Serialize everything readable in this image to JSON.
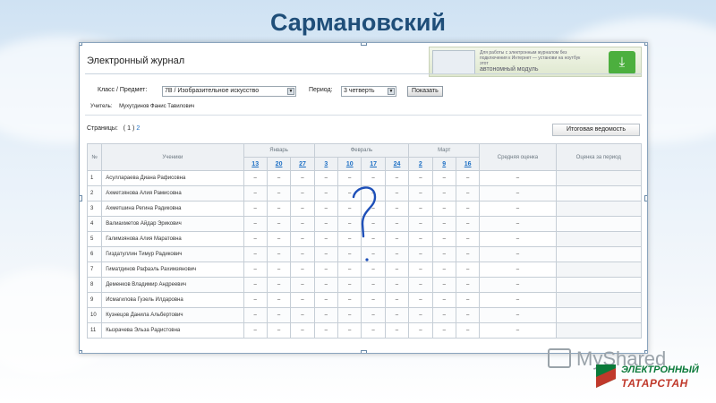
{
  "slide": {
    "title": "Сармановский"
  },
  "journal": {
    "title": "Электронный журнал",
    "promo": {
      "text": "Для работы с электронным журналом без подключения к Интернет — установи на ноутбук этот",
      "module_label": "автономный модуль",
      "download_icon": "download-icon"
    },
    "filters": {
      "class_label": "Класс / Предмет:",
      "class_value": "7В / Изобразительное искусство",
      "period_label": "Период:",
      "period_value": "3 четверть",
      "show_button": "Показать"
    },
    "teacher": {
      "label": "Учитель:",
      "name": "Мухутдинов Фанис Тавилович"
    },
    "pages": {
      "label": "Страницы:",
      "open": "(",
      "current": "1",
      "close": ")",
      "next": "2"
    },
    "summary_button": "Итоговая ведомость",
    "table": {
      "col_num": "№",
      "col_students": "Ученики",
      "months": [
        "Январь",
        "Февраль",
        "Март"
      ],
      "dates": [
        "13",
        "20",
        "27",
        "3",
        "10",
        "17",
        "24",
        "2",
        "9",
        "16"
      ],
      "col_avg": "Средняя оценка",
      "col_period": "Оценка за период",
      "rows": [
        {
          "num": "1",
          "name": "Асуллараева Диана Рафисовна"
        },
        {
          "num": "2",
          "name": "Ахметзянова Алия Рамисовна"
        },
        {
          "num": "3",
          "name": "Ахметшина Регина Радиковна"
        },
        {
          "num": "4",
          "name": "Валиахметов Айдар Эрикович"
        },
        {
          "num": "5",
          "name": "Галимзянова Алия Маратовна"
        },
        {
          "num": "6",
          "name": "Гиздатуллин Тимур Радикович"
        },
        {
          "num": "7",
          "name": "Гиматдинов Рафаэль Рахимзянович"
        },
        {
          "num": "8",
          "name": "Деменков Владимир Андреевич"
        },
        {
          "num": "9",
          "name": "Исмагилова Гузель Илдаровна"
        },
        {
          "num": "10",
          "name": "Кузнецов Данила Альбертович"
        },
        {
          "num": "11",
          "name": "Кызрачева Эльза Радистовна"
        }
      ],
      "empty_mark": "–"
    }
  },
  "watermark": {
    "text": "MyShared"
  },
  "brand": {
    "line1": "ЭЛЕКТРОННЫЙ",
    "line2": "ТАТАРСТАН"
  }
}
